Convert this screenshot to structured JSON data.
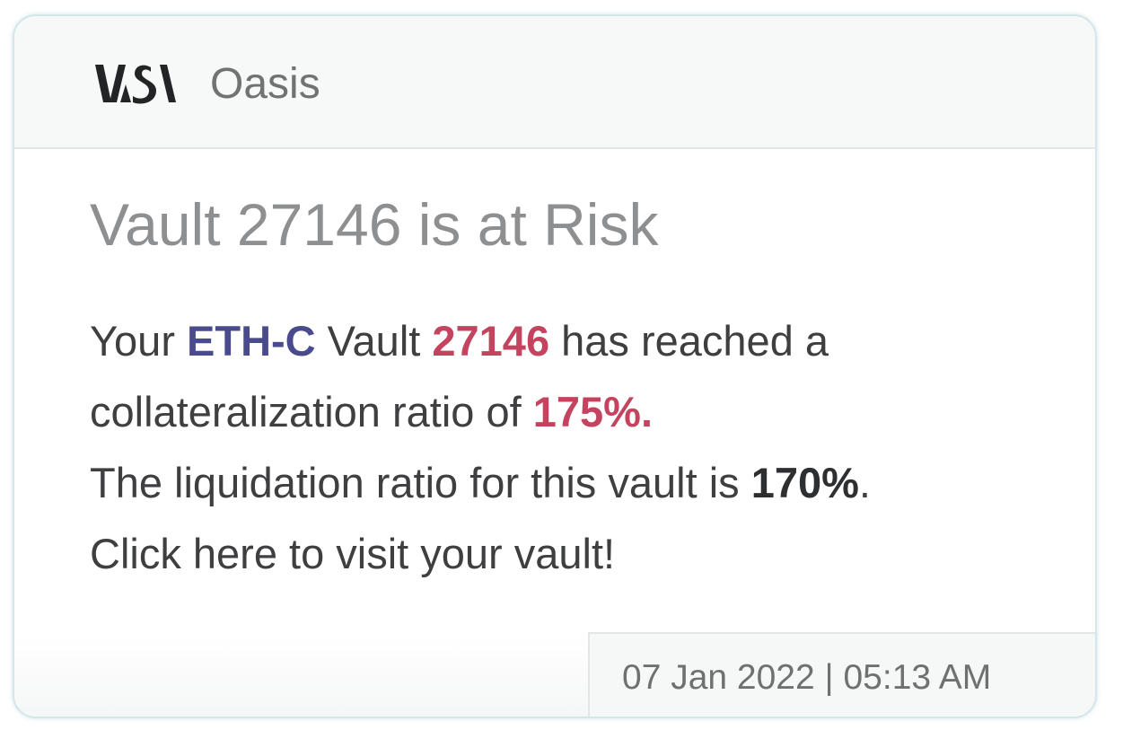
{
  "notification": {
    "app_name": "Oasis",
    "title": "Vault 27146 is at Risk",
    "body": {
      "line1": {
        "prefix": "Your ",
        "asset": "ETH-C",
        "mid": " Vault ",
        "vault_id": "27146",
        "suffix": " has reached a"
      },
      "line2": {
        "prefix": "collateralization ratio of ",
        "ratio": "175%",
        "suffix": "."
      },
      "line3": {
        "prefix": "The liquidation ratio for this vault is ",
        "ratio": "170%",
        "suffix": "."
      },
      "line4": "Click here to visit your vault!"
    },
    "timestamp": "07 Jan 2022 | 05:13 AM"
  },
  "icons": {
    "logo": "app-logo-icon"
  },
  "colors": {
    "asset_highlight": "#4a4b8c",
    "value_highlight": "#c4445f",
    "border": "#d3e7ea"
  }
}
